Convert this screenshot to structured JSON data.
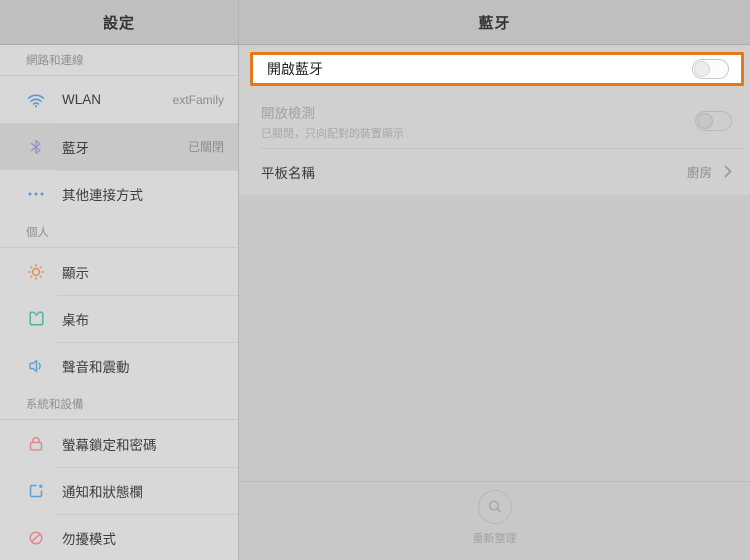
{
  "colors": {
    "highlight_border": "#e5791a",
    "sidebar_bg": "#d8d8d8",
    "selected_row_bg": "#c8c8c8",
    "header_bg": "#bfbfbf"
  },
  "sidebar": {
    "title": "設定",
    "sections": [
      {
        "label": "網路和連線",
        "items": [
          {
            "icon": "wifi-icon",
            "label": "WLAN",
            "value": "extFamily",
            "selected": false
          },
          {
            "icon": "bluetooth-icon",
            "label": "藍牙",
            "value": "已關閉",
            "selected": true
          },
          {
            "icon": "more-connections-icon",
            "label": "其他連接方式",
            "value": "",
            "selected": false
          }
        ]
      },
      {
        "label": "個人",
        "items": [
          {
            "icon": "display-icon",
            "label": "顯示"
          },
          {
            "icon": "wallpaper-icon",
            "label": "桌布"
          },
          {
            "icon": "sound-icon",
            "label": "聲音和震動"
          }
        ]
      },
      {
        "label": "系統和設備",
        "items": [
          {
            "icon": "lock-icon",
            "label": "螢幕鎖定和密碼"
          },
          {
            "icon": "notifications-icon",
            "label": "通知和狀態欄"
          },
          {
            "icon": "dnd-icon",
            "label": "勿擾模式"
          }
        ]
      }
    ]
  },
  "main": {
    "title": "藍牙",
    "bluetooth_toggle": {
      "label": "開啟藍牙",
      "state": "off",
      "highlighted": true
    },
    "discoverable": {
      "label": "開放檢測",
      "subtitle": "已關閉，只向配對的裝置顯示",
      "state": "off",
      "disabled": true
    },
    "device_name": {
      "label": "平板名稱",
      "value": "廚房"
    },
    "refresh": {
      "label": "重新整理"
    }
  }
}
